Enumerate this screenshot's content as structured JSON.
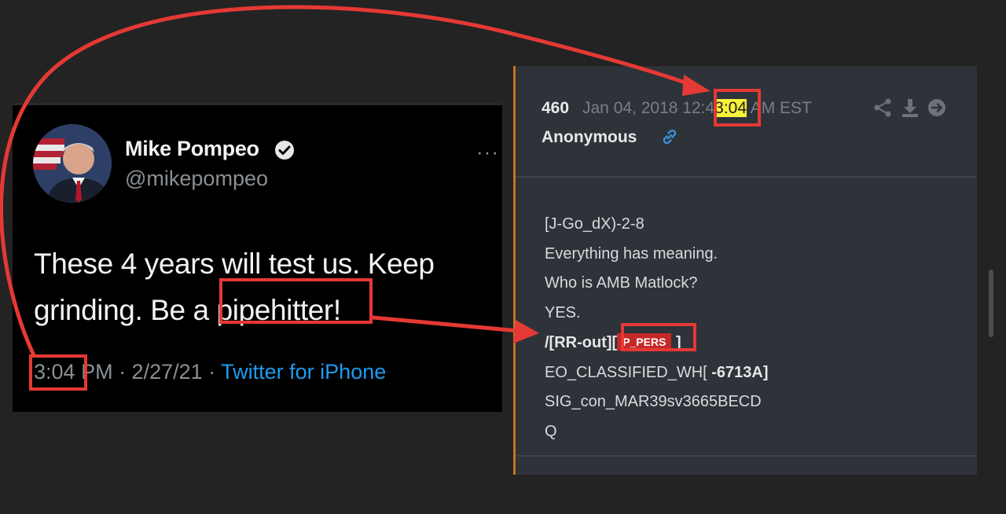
{
  "tweet": {
    "name": "Mike Pompeo",
    "handle": "@mikepompeo",
    "more": "···",
    "text_line1": "These 4 years will test us. Keep",
    "text_line2_pre": "grinding. Be a ",
    "text_line2_hl": "pipehitter!",
    "time": "3:04",
    "meta_rest": " PM · 2/27/21 · ",
    "source": "Twitter for iPhone"
  },
  "qpost": {
    "number": "460",
    "date_pre": "Jan 04, 2018 12:4",
    "date_hl": "3:04",
    "date_post": " AM EST",
    "author": "Anonymous",
    "lines": {
      "l1": "[J-Go_dX)-2-8",
      "l2": "Everything has meaning.",
      "l3": "Who is AMB Matlock?",
      "l4": "YES.",
      "l5_pre": "/[RR-out][",
      "l5_tag": "P_PERS",
      "l5_post": " ]",
      "l6_pre": "EO_CLASSIFIED_WH[",
      "l6_post": "   -6713A]",
      "l7": "SIG_con_MAR39sv3665BECD",
      "l8": "Q"
    }
  },
  "colors": {
    "annotation": "#e53935",
    "highlight": "#f7f23a",
    "twitter_blue": "#1d9bf0",
    "post_accent": "#c9731f"
  }
}
